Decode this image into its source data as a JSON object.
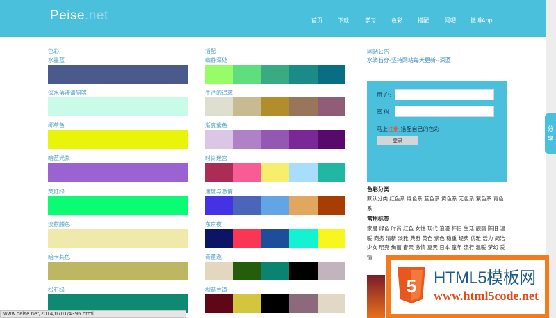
{
  "header": {
    "logo_main": "Peise",
    "logo_dot": ".net",
    "nav": [
      "首页",
      "下载",
      "学习",
      "色彩",
      "搭配",
      "问吧",
      "微博App"
    ]
  },
  "colors_column": {
    "title": "色彩",
    "items": [
      {
        "name": "水墨蓝",
        "color": "#4a5a8c"
      },
      {
        "name": "深水落漾清猎咯",
        "color": "#c8fbe8"
      },
      {
        "name": "椰草色",
        "color": "#e8f50a"
      },
      {
        "name": "暗蓝光紫",
        "color": "#9b62d1"
      },
      {
        "name": "荧红绿",
        "color": "#0cfb74"
      },
      {
        "name": "淡麒麟色",
        "color": "#f1e8ac"
      },
      {
        "name": "暗卡其色",
        "color": "#bdb763"
      },
      {
        "name": "松石绿",
        "color": "#0e8a72"
      }
    ]
  },
  "combos_column": {
    "title": "搭配",
    "items": [
      {
        "name": "幽静深处",
        "colors": [
          "#96fd68",
          "#5fde7c",
          "#3aaa82",
          "#1a8b86",
          "#096e83"
        ]
      },
      {
        "name": "生活的追求",
        "colors": [
          "#dfdfcf",
          "#c8bb92",
          "#b18d2c",
          "#98755b",
          "#915c77"
        ]
      },
      {
        "name": "渐变紫色",
        "colors": [
          "#dcc6e6",
          "#b181c8",
          "#9458b3",
          "#7a2898",
          "#570a6c"
        ]
      },
      {
        "name": "时尚迷宫",
        "colors": [
          "#ab2d55",
          "#f95b95",
          "#f6ee6c",
          "#a8defc",
          "#21b8a3"
        ]
      },
      {
        "name": "速度与激情",
        "colors": [
          "#4532e5",
          "#4b65bb",
          "#62a5e6",
          "#e2a75e",
          "#a83d04"
        ]
      },
      {
        "name": "东京夜",
        "colors": [
          "#0b1465",
          "#fa3654",
          "#1c4e9b",
          "#13f3d2",
          "#f8f61f"
        ]
      },
      {
        "name": "青蓝邀",
        "colors": [
          "#e4d7bf",
          "#255d0c",
          "#0a8470",
          "#000000",
          "#c1b4bc"
        ]
      },
      {
        "name": "穆赫兰道",
        "colors": [
          "#5f0717",
          "#d4c53f",
          "#000000",
          "#8b6a7b",
          "#e1d8c6"
        ]
      }
    ]
  },
  "sidebar": {
    "notice_title": "网站公告",
    "notice_text": "水滴石穿-坚持网站每天更新--深蓝",
    "login": {
      "user_label": "用 户:",
      "pass_label": "密 码:",
      "promo_prefix": "马上",
      "promo_link": "注册",
      "promo_suffix": ",搭配自己的色彩",
      "login_button": "登录"
    },
    "category_title": "色彩分类",
    "category_text": "默认分类 红色系 绿色系 蓝色系 黄色系 无色系 紫色系 青色系",
    "tags_title": "常用标签",
    "tags_text": "家居 绿色 时尚 红色 女性 现代 浪漫 怀旧 生活 靓丽 陈旧 温暖 商务 清新 淡雅 典雅 黄色 紫色 稳重 经典 优雅 活力 简洁 少女 明亮 绚丽 春天 激情 夏天 日本 童年 流行 温暖 梦幻 爱情"
  },
  "side_tab": "分享",
  "watermark": {
    "title": "HTML5模板网",
    "url": "www.html5code.net",
    "shield_number": "5"
  },
  "status_url": "www.peise.net/2014/0701/4396.html"
}
